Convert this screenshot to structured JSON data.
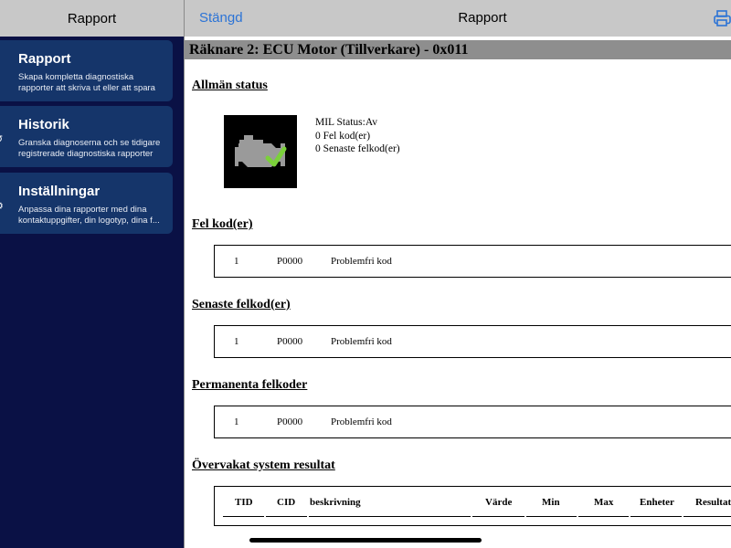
{
  "left_header": {
    "title": "Rapport"
  },
  "right_header": {
    "close_label": "Stängd",
    "title": "Rapport",
    "print_icon": "printer-icon"
  },
  "sidebar": {
    "items": [
      {
        "title": "Rapport",
        "desc1": "Skapa kompletta diagnostiska",
        "desc2": "rapporter att skriva ut eller att spara",
        "icon": "document-icon"
      },
      {
        "title": "Historik",
        "desc1": "Granska diagnoserna och se tidigare",
        "desc2": "registrerade diagnostiska rapporter",
        "icon": "history-icon"
      },
      {
        "title": "Inställningar",
        "desc1": "Anpassa dina rapporter med dina",
        "desc2": "kontaktuppgifter, din logotyp, dina f...",
        "icon": "settings-icon"
      }
    ]
  },
  "report": {
    "title": "Räknare 2: ECU Motor (Tillverkare) - 0x011",
    "general_status": {
      "heading": "Allmän status",
      "lines": [
        "MIL Status:Av",
        "0 Fel kod(er)",
        "0 Senaste felkod(er)"
      ]
    },
    "fault_codes": {
      "heading": "Fel kod(er)",
      "num": "1",
      "code": "P0000",
      "desc": "Problemfri kod"
    },
    "recent_codes": {
      "heading": "Senaste felkod(er)",
      "num": "1",
      "code": "P0000",
      "desc": "Problemfri kod"
    },
    "permanent_codes": {
      "heading": "Permanenta felkoder",
      "num": "1",
      "code": "P0000",
      "desc": "Problemfri kod"
    },
    "monitored": {
      "heading": "Övervakat system resultat",
      "columns": [
        "TID",
        "CID",
        "beskrivning",
        "Värde",
        "Min",
        "Max",
        "Enheter",
        "Resultat"
      ]
    }
  },
  "colors": {
    "sidebar_bg": "#0a1145",
    "menu_item_bg": "#15356a",
    "header_bg": "#c8c8c8",
    "accent_blue": "#2b73d6",
    "check_green": "#7bd13a"
  }
}
